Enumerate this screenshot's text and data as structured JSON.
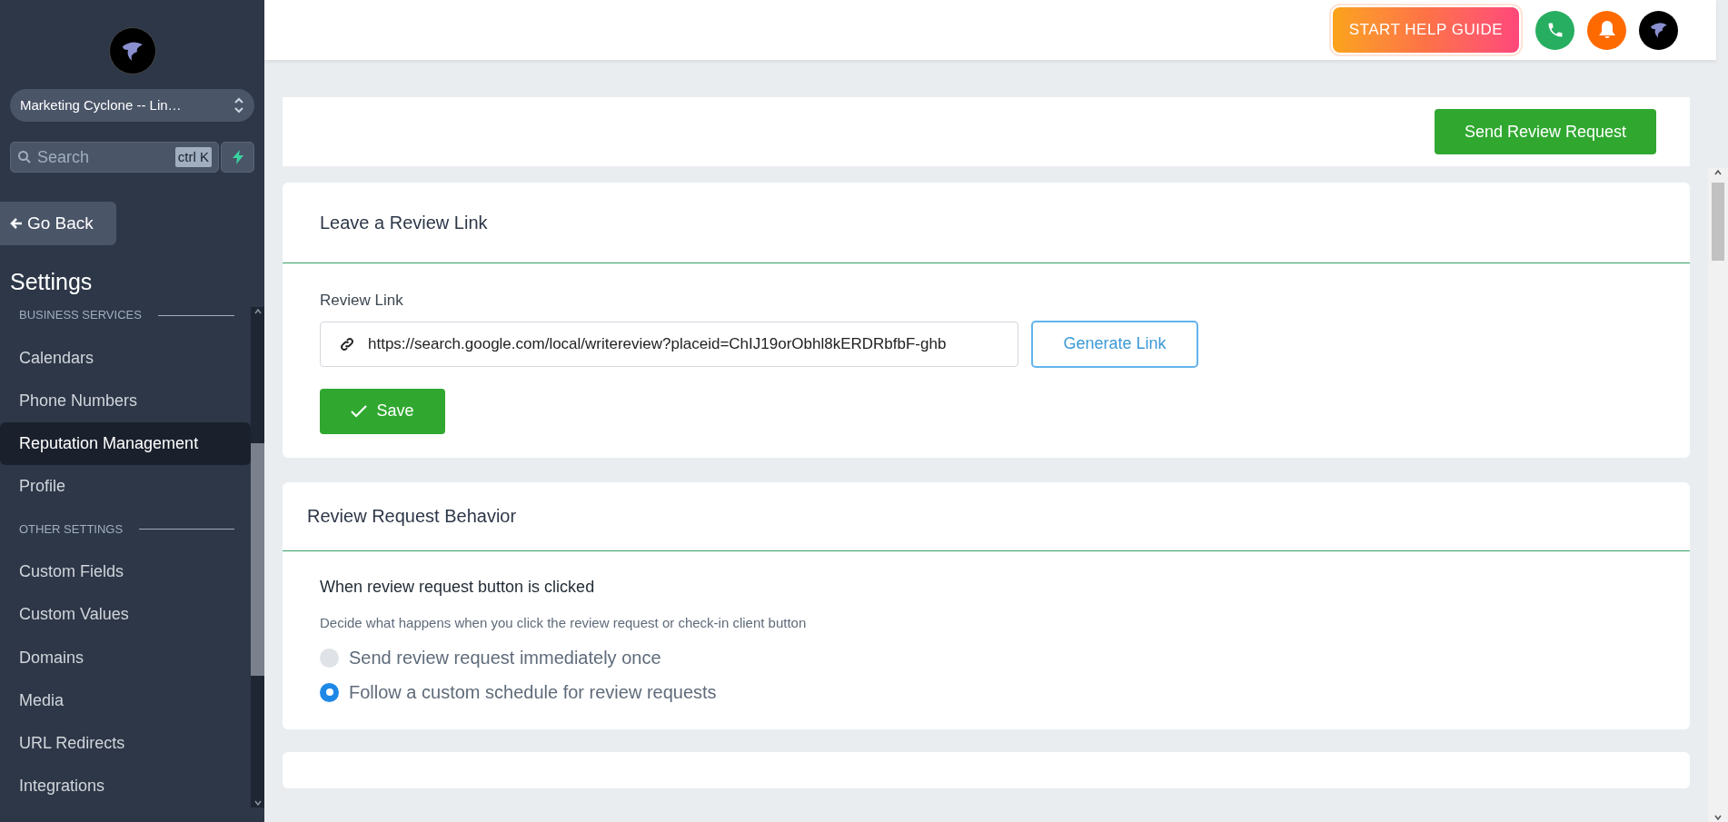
{
  "sidebar": {
    "account": "Marketing Cyclone -- Lin…",
    "search": {
      "placeholder": "Search",
      "shortcut": "ctrl K"
    },
    "back": "Go Back",
    "title": "Settings",
    "items": [
      {
        "kind": "section",
        "label": "BUSINESS SERVICES"
      },
      {
        "kind": "link",
        "label": "Calendars",
        "selected": false
      },
      {
        "kind": "link",
        "label": "Phone Numbers",
        "selected": false
      },
      {
        "kind": "link",
        "label": "Reputation Management",
        "selected": true
      },
      {
        "kind": "link",
        "label": "Profile",
        "selected": false
      },
      {
        "kind": "section",
        "label": "OTHER SETTINGS"
      },
      {
        "kind": "link",
        "label": "Custom Fields",
        "selected": false
      },
      {
        "kind": "link",
        "label": "Custom Values",
        "selected": false
      },
      {
        "kind": "link",
        "label": "Domains",
        "selected": false
      },
      {
        "kind": "link",
        "label": "Media",
        "selected": false
      },
      {
        "kind": "link",
        "label": "URL Redirects",
        "selected": false
      },
      {
        "kind": "link",
        "label": "Integrations",
        "selected": false
      }
    ]
  },
  "header": {
    "help_button": "START HELP GUIDE"
  },
  "top_card": {
    "button": "Send Review Request"
  },
  "review_link_card": {
    "title": "Leave a Review Link",
    "field_label": "Review Link",
    "value": "https://search.google.com/local/writereview?placeid=ChIJ19orObhl8kERDRbfbF-ghb",
    "generate_button": "Generate Link",
    "save_button": "Save"
  },
  "behavior_card": {
    "title": "Review Request Behavior",
    "question": "When review request button is clicked",
    "hint": "Decide what happens when you click the review request or check-in client button",
    "options": [
      {
        "label": "Send review request immediately once",
        "selected": false
      },
      {
        "label": "Follow a custom schedule for review requests",
        "selected": true
      }
    ]
  }
}
